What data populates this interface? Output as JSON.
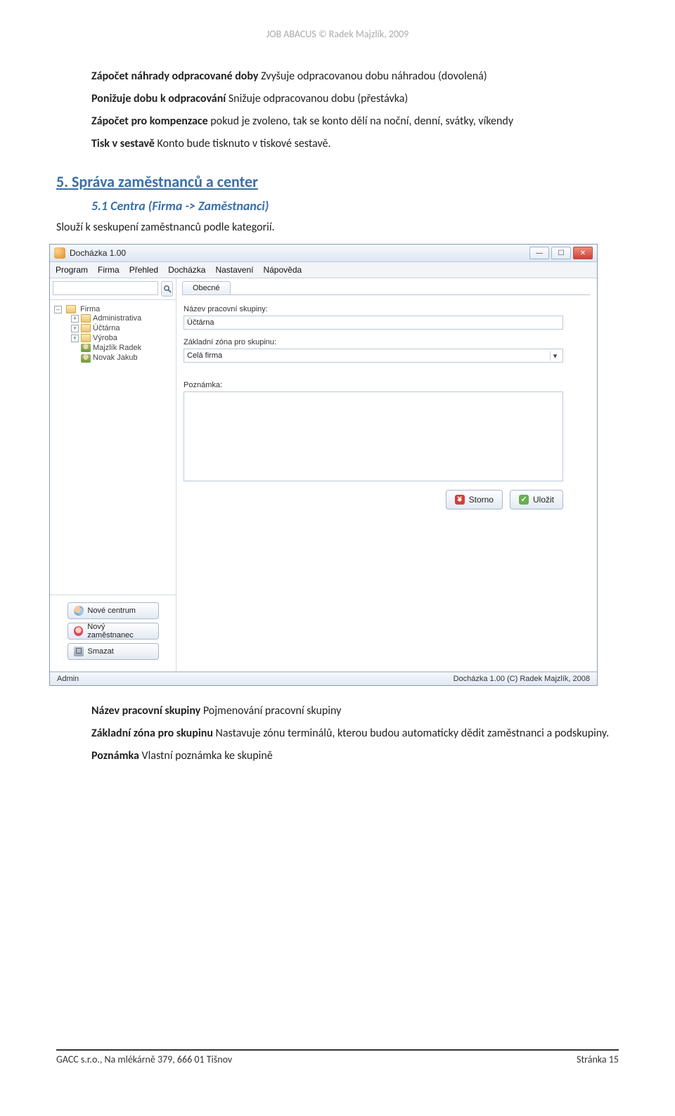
{
  "doc_header": "JOB ABACUS © Radek Majzlík, 2009",
  "text_block_1": [
    {
      "label": "Zápočet náhrady odpracované doby",
      "rest": " Zvyšuje odpracovanou dobu náhradou (dovolená)"
    },
    {
      "label": "Ponižuje dobu k odpracování",
      "rest": " Snižuje odpracovanou dobu (přestávka)"
    },
    {
      "label": "Zápočet pro kompenzace",
      "rest": " pokud je zvoleno, tak se konto dělí na noční, denní, svátky, víkendy"
    },
    {
      "label": "Tisk v sestavě",
      "rest": " Konto bude tisknuto v tiskové sestavě."
    }
  ],
  "heading2": "5. Správa zaměstnanců a center",
  "heading3": "5.1 Centra (Firma -> Zaměstnanci)",
  "para_before": "Slouží k seskupení zaměstnanců podle kategorií.",
  "text_block_2_intro": "",
  "text_block_2": [
    {
      "label": "Název pracovní skupiny",
      "rest": " Pojmenování pracovní skupiny"
    },
    {
      "label": "Základní zóna pro skupinu",
      "rest": " Nastavuje zónu terminálů, kterou budou automaticky dědit zaměstnanci a podskupiny."
    },
    {
      "label": "Poznámka",
      "rest": " Vlastní poznámka ke skupině"
    }
  ],
  "footer": {
    "left": "GACC s.r.o., Na mlékárně 379, 666 01 Tišnov",
    "right": "Stránka 15"
  },
  "app": {
    "title": "Docházka 1.00",
    "menu": [
      "Program",
      "Firma",
      "Přehled",
      "Docházka",
      "Nastavení",
      "Nápověda"
    ],
    "search_value": "",
    "tree": {
      "root": "Firma",
      "groups": [
        "Administrativa",
        "Účtárna",
        "Výroba"
      ],
      "people": [
        "Majzlík Radek",
        "Novak Jakub"
      ]
    },
    "side_buttons": {
      "new_center": "Nové centrum",
      "new_employee": "Nový zaměstnanec",
      "delete": "Smazat"
    },
    "tab": "Obecné",
    "form": {
      "group_name_label": "Název pracovní skupiny:",
      "group_name_value": "Účtárna",
      "zone_label": "Základní zóna pro skupinu:",
      "zone_value": "Celá firma",
      "note_label": "Poznámka:",
      "note_value": ""
    },
    "actions": {
      "cancel": "Storno",
      "save": "Uložit"
    },
    "status": {
      "left": "Admin",
      "right": "Docházka 1.00 (C) Radek Majzlík, 2008"
    }
  }
}
